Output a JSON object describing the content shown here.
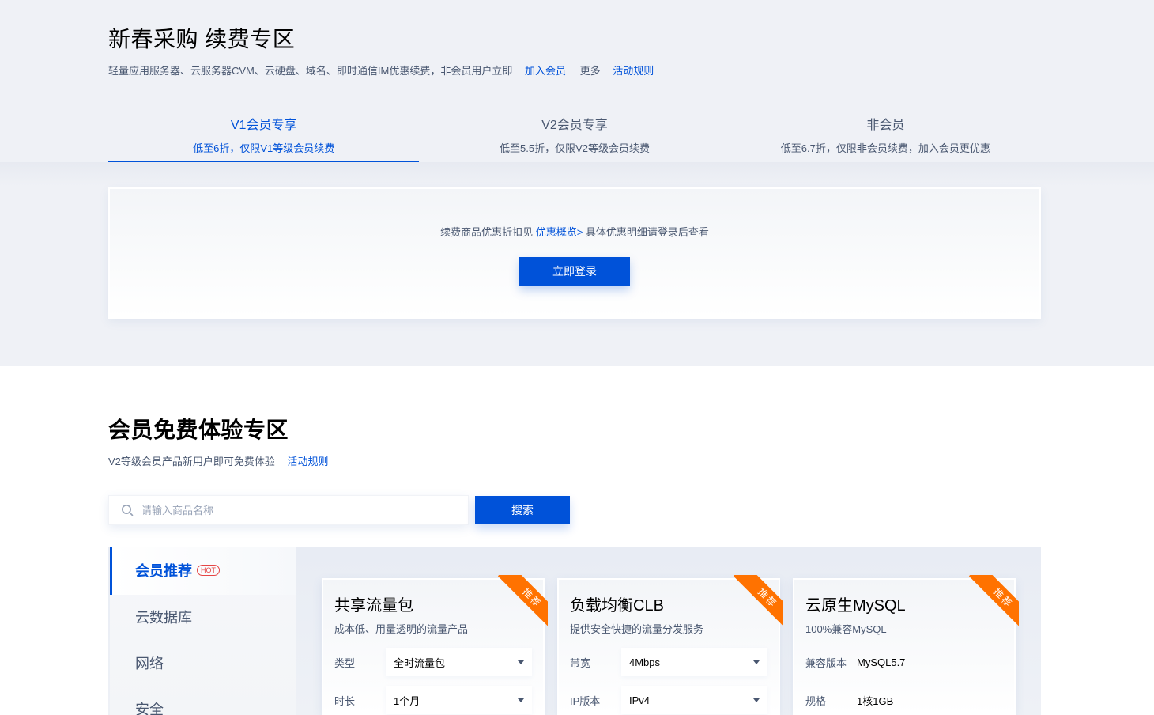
{
  "renewal": {
    "title": "新春采购 续费专区",
    "desc": "轻量应用服务器、云服务器CVM、云硬盘、域名、即时通信IM优惠续费，非会员用户立即",
    "join_link": "加入会员",
    "more_text": "更多",
    "rules_link": "活动规则",
    "tabs": [
      {
        "label": "V1会员专享",
        "sub": "低至6折，仅限V1等级会员续费"
      },
      {
        "label": "V2会员专享",
        "sub": "低至5.5折，仅限V2等级会员续费"
      },
      {
        "label": "非会员",
        "sub": "低至6.7折，仅限非会员续费，加入会员更优惠"
      }
    ],
    "login_tip_before": "续费商品优惠折扣见 ",
    "login_tip_link": "优惠概览>",
    "login_tip_after": " 具体优惠明细请登录后查看",
    "login_button": "立即登录"
  },
  "trial": {
    "title": "会员免费体验专区",
    "desc": "V2等级会员产品新用户即可免费体验",
    "rules_link": "活动规则",
    "search_placeholder": "请输入商品名称",
    "search_button": "搜索",
    "sidebar": [
      {
        "label": "会员推荐",
        "badge": "HOT"
      },
      {
        "label": "云数据库"
      },
      {
        "label": "网络"
      },
      {
        "label": "安全"
      }
    ],
    "cards": [
      {
        "title": "共享流量包",
        "sub": "成本低、用量透明的流量产品",
        "ribbon": "推荐",
        "rows": [
          {
            "label": "类型",
            "value": "全时流量包"
          },
          {
            "label": "时长",
            "value": "1个月"
          }
        ]
      },
      {
        "title": "负载均衡CLB",
        "sub": "提供安全快捷的流量分发服务",
        "ribbon": "推荐",
        "rows": [
          {
            "label": "带宽",
            "value": "4Mbps"
          },
          {
            "label": "IP版本",
            "value": "IPv4"
          }
        ]
      },
      {
        "title": "云原生MySQL",
        "sub": "100%兼容MySQL",
        "ribbon": "推荐",
        "rows": [
          {
            "label": "兼容版本",
            "value": "MySQL5.7"
          },
          {
            "label": "规格",
            "value": "1核1GB"
          }
        ]
      }
    ]
  },
  "colors": {
    "accent": "#0052d9",
    "ribbon": "#ff7200",
    "hot": "#e54545",
    "text_secondary": "#495770",
    "section_bg": "#eff1f6"
  },
  "icons": {
    "search": "search-icon",
    "dropdown": "caret-down-icon"
  }
}
